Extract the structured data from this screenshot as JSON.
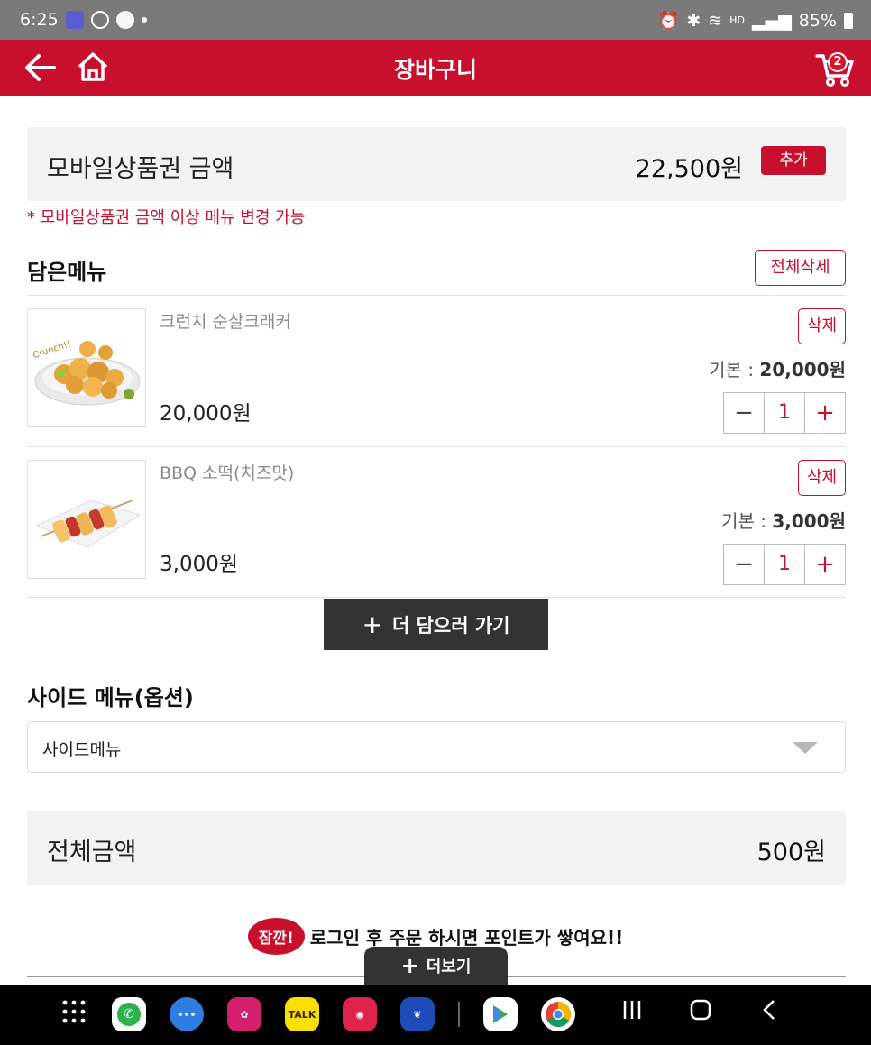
{
  "status_bar": {
    "time": "6:25",
    "battery": "85%"
  },
  "header": {
    "title": "장바구니",
    "cart_count": "2"
  },
  "voucher": {
    "label": "모바일상품권 금액",
    "amount": "22,500원",
    "add_label": "추가",
    "note": "* 모바일상품권 금액 이상 메뉴 변경 가능"
  },
  "cart": {
    "title": "담은메뉴",
    "delete_all_label": "전체삭제",
    "items": [
      {
        "name": "크런치 순살크래커",
        "price": "20,000원",
        "base_label": "기본 : ",
        "base_price": "20,000원",
        "delete_label": "삭제",
        "quantity": "1"
      },
      {
        "name": "BBQ 소떡(치즈맛)",
        "price": "3,000원",
        "base_label": "기본 : ",
        "base_price": "3,000원",
        "delete_label": "삭제",
        "quantity": "1"
      }
    ],
    "add_more_label": "더 담으러 가기"
  },
  "side_menu": {
    "title": "사이드 메뉴(옵션)",
    "selected": "사이드메뉴"
  },
  "total": {
    "label": "전체금액",
    "amount": "500원"
  },
  "notice": {
    "badge": "잠깐!",
    "text": "로그인 후 주문 하시면 포인트가 쌓여요!!"
  },
  "fold_tab": {
    "label": "더보기"
  },
  "dock_apps": [
    "phone-app",
    "messages-app",
    "gallery-app",
    "kakaotalk-app",
    "camera-app",
    "internet-app",
    "play-store-app",
    "chrome-app"
  ],
  "colors": {
    "brand_red": "#c8102e",
    "panel_gray": "#f2f2f2",
    "dark_button": "#333333"
  }
}
